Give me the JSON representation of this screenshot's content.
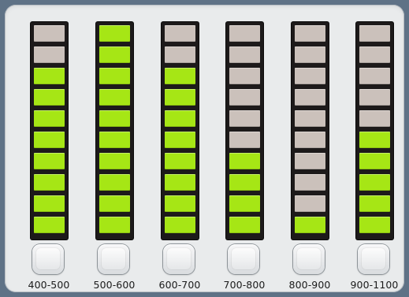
{
  "colors": {
    "lit": "#a6e615",
    "unlit": "#cbc1bb"
  },
  "segments_per_meter": 10,
  "channels": [
    {
      "label": "400-500",
      "level": 8
    },
    {
      "label": "500-600",
      "level": 10
    },
    {
      "label": "600-700",
      "level": 8
    },
    {
      "label": "700-800",
      "level": 4
    },
    {
      "label": "800-900",
      "level": 1
    },
    {
      "label": "900-1100",
      "level": 5
    }
  ]
}
